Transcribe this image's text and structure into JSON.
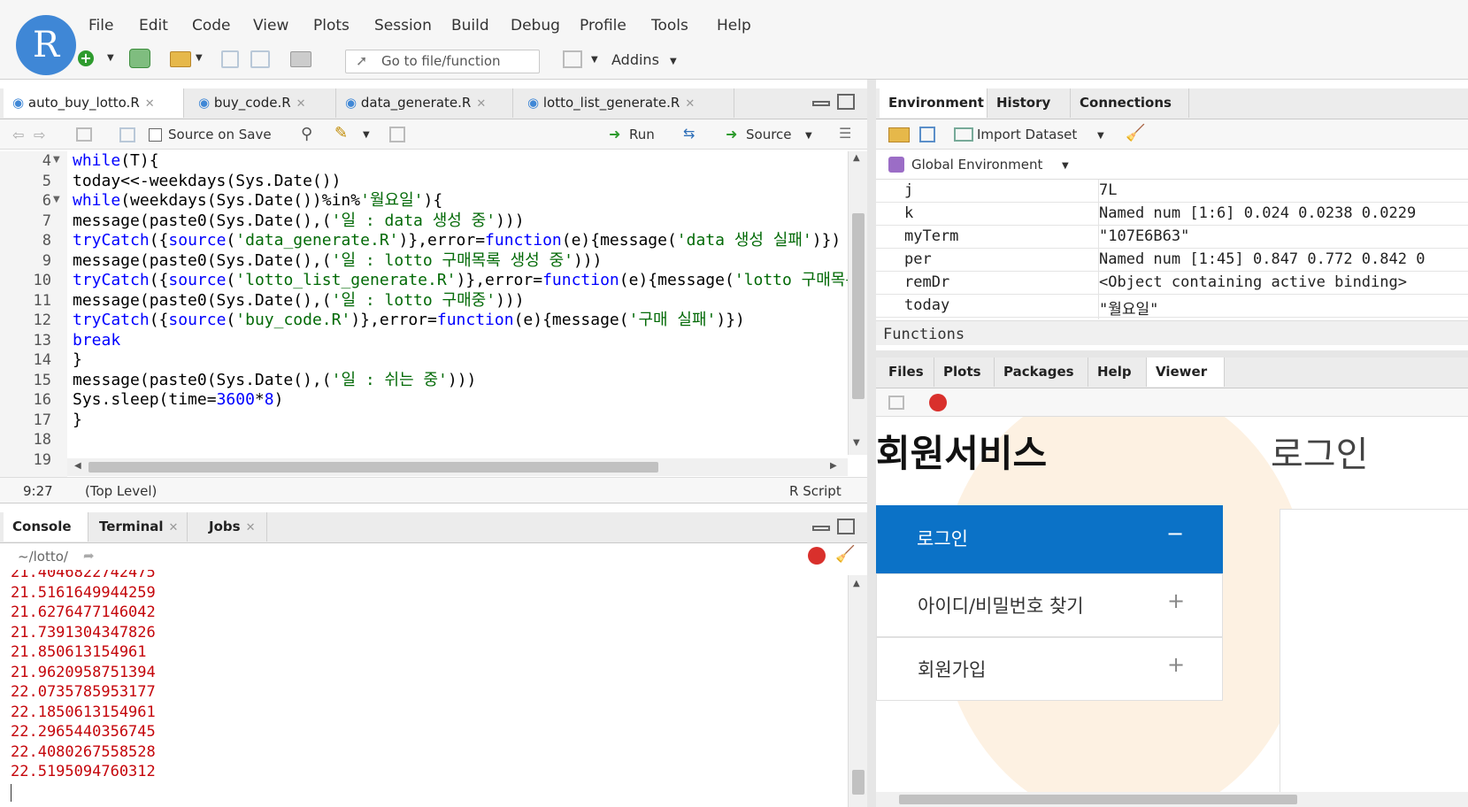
{
  "menu": {
    "items": [
      "File",
      "Edit",
      "Code",
      "View",
      "Plots",
      "Session",
      "Build",
      "Debug",
      "Profile",
      "Tools",
      "Help"
    ],
    "logo": "R"
  },
  "toolbar": {
    "goto_placeholder": "Go to file/function",
    "addins": "Addins"
  },
  "editor": {
    "tabs": [
      "auto_buy_lotto.R",
      "buy_code.R",
      "data_generate.R",
      "lotto_list_generate.R"
    ],
    "source_on_save": "Source on Save",
    "run": "Run",
    "source": "Source",
    "line_numbers": [
      "4",
      "5",
      "6",
      "7",
      "8",
      "9",
      "10",
      "11",
      "12",
      "13",
      "14",
      "15",
      "16",
      "17",
      "18",
      "19"
    ],
    "cursor_pos": "9:27",
    "scope": "(Top Level)",
    "filetype": "R Script"
  },
  "console": {
    "tabs": [
      "Console",
      "Terminal",
      "Jobs"
    ],
    "path": "~/lotto/",
    "lines": [
      "21.4046822742475",
      "21.5161649944259",
      "21.6276477146042",
      "21.7391304347826",
      "21.850613154961",
      "21.9620958751394",
      "22.0735785953177",
      "22.1850613154961",
      "22.2965440356745",
      "22.4080267558528",
      "22.5195094760312"
    ]
  },
  "env": {
    "tabs": [
      "Environment",
      "History",
      "Connections"
    ],
    "import": "Import Dataset",
    "scope": "Global Environment",
    "rows": [
      {
        "name": "j",
        "value": "7L"
      },
      {
        "name": "k",
        "value": "Named num [1:6] 0.024 0.0238 0.0229"
      },
      {
        "name": "myTerm",
        "value": "\"107E6B63\""
      },
      {
        "name": "per",
        "value": "Named num [1:45] 0.847 0.772 0.842 0"
      },
      {
        "name": "remDr",
        "value": "<Object containing active binding>"
      },
      {
        "name": "today",
        "value": "\"월요일\""
      }
    ],
    "functions": "Functions"
  },
  "files": {
    "tabs": [
      "Files",
      "Plots",
      "Packages",
      "Help",
      "Viewer"
    ]
  },
  "viewer": {
    "title": "회원서비스",
    "login_heading": "로그인",
    "items": [
      {
        "label": "로그인",
        "sign": "−"
      },
      {
        "label": "아이디/비밀번호 찾기",
        "sign": "+"
      },
      {
        "label": "회원가입",
        "sign": "+"
      }
    ]
  },
  "colors": {
    "accent": "#0b72c7",
    "logo": "#3f87d6"
  }
}
